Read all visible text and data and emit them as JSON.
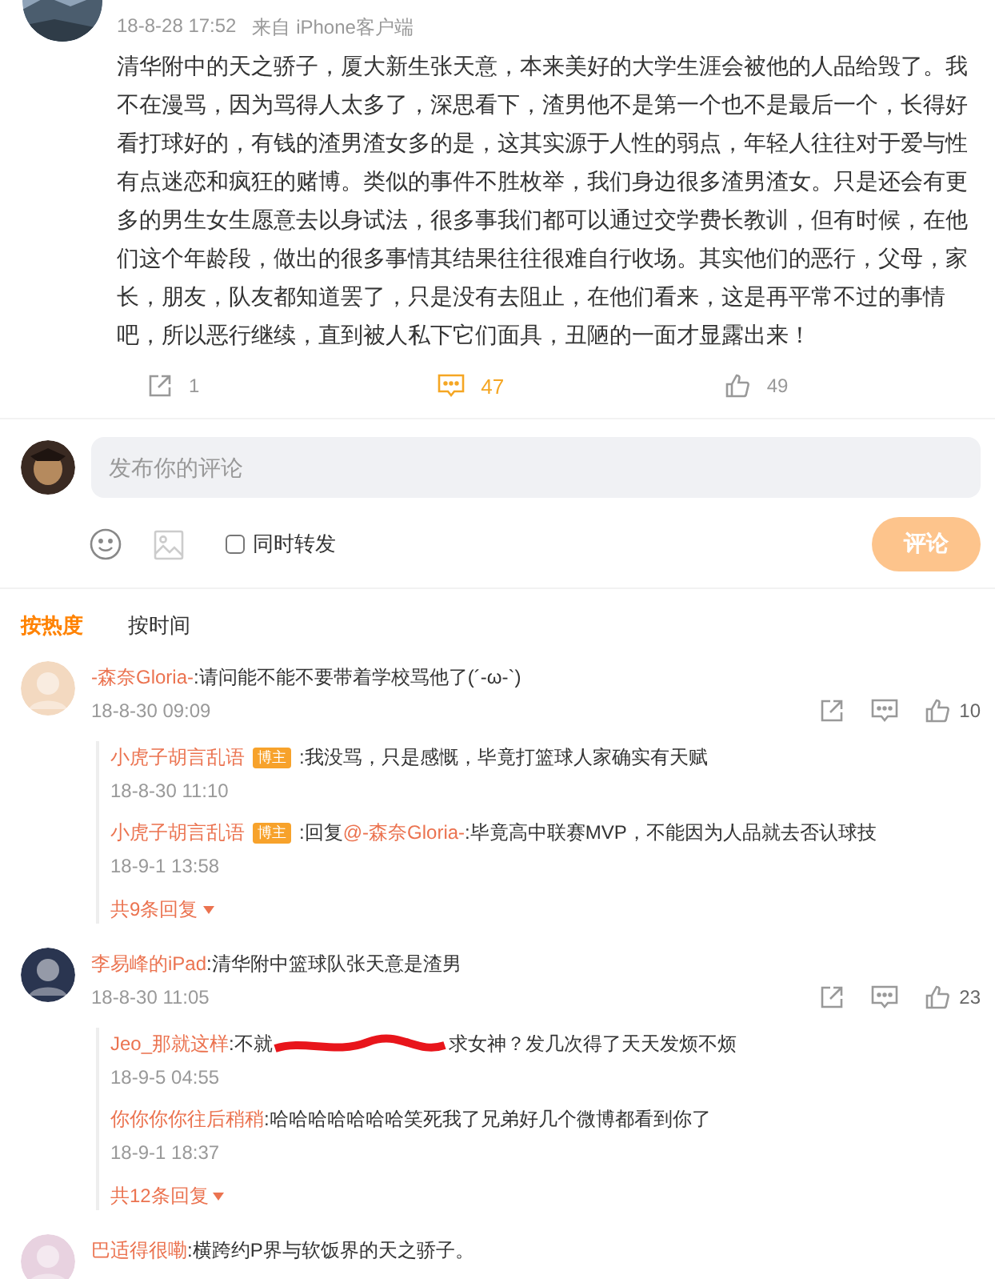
{
  "post": {
    "time": "18-8-28 17:52",
    "source": "来自 iPhone客户端",
    "text": "清华附中的天之骄子，厦大新生张天意，本来美好的大学生涯会被他的人品给毁了。我不在漫骂，因为骂得人太多了，深思看下，渣男他不是第一个也不是最后一个，长得好看打球好的，有钱的渣男渣女多的是，这其实源于人性的弱点，年轻人往往对于爱与性有点迷恋和疯狂的赌博。类似的事件不胜枚举，我们身边很多渣男渣女。只是还会有更多的男生女生愿意去以身试法，很多事我们都可以通过交学费长教训，但有时候，在他们这个年龄段，做出的很多事情其结果往往很难自行收场。其实他们的恶行，父母，家长，朋友，队友都知道罢了，只是没有去阻止，在他们看来，这是再平常不过的事情吧，所以恶行继续，直到被人私下它们面具，丑陋的一面才显露出来！",
    "actions": [
      {
        "kind": "repost",
        "count": "1",
        "active": false
      },
      {
        "kind": "comment",
        "count": "47",
        "active": true
      },
      {
        "kind": "like",
        "count": "49",
        "active": false
      }
    ]
  },
  "composer": {
    "placeholder": "发布你的评论",
    "repost_label": "同时转发",
    "repost_checked": false,
    "submit_label": "评论"
  },
  "sort_tabs": [
    {
      "label": "按热度",
      "selected": true
    },
    {
      "label": "按时间",
      "selected": false
    }
  ],
  "comments": [
    {
      "author": "-森奈Gloria-",
      "text": ":请问能不能不要带着学校骂他了(´-ω-`)",
      "time": "18-8-30 09:09",
      "likes": "10",
      "replies": [
        {
          "author": "小虎子胡言乱语",
          "badge": "博主",
          "text": ":我没骂，只是感慨，毕竟打篮球人家确实有天赋",
          "time": "18-8-30 11:10"
        },
        {
          "author": "小虎子胡言乱语",
          "badge": "博主",
          "text": ":回复",
          "mention": "@-森奈Gloria-",
          "text_after": ":毕竟高中联赛MVP，不能因为人品就去否认球技",
          "time": "18-9-1 13:58"
        }
      ],
      "more": "共9条回复"
    },
    {
      "author": "李易峰的iPad",
      "text": ":清华附中篮球队张天意是渣男",
      "time": "18-8-30 11:05",
      "likes": "23",
      "replies": [
        {
          "author": "Jeo_那就这样",
          "text": ":不就",
          "redacted": true,
          "text_after": "求女神？发几次得了天天发烦不烦",
          "time": "18-9-5 04:55"
        },
        {
          "author": "你你你你往后稍稍",
          "text": ":哈哈哈哈哈哈哈笑死我了兄弟好几个微博都看到你了",
          "time": "18-9-1 18:37"
        }
      ],
      "more": "共12条回复"
    },
    {
      "author": "巴适得很嘞",
      "text": ":横跨约P界与软饭界的天之骄子。"
    }
  ]
}
